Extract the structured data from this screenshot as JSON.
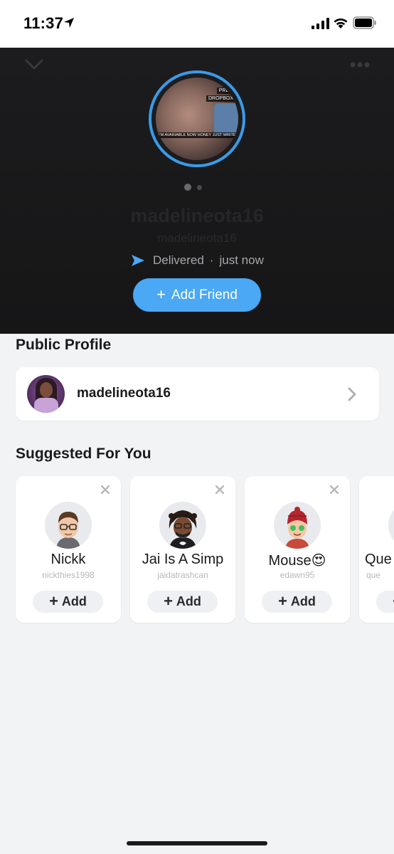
{
  "status_bar": {
    "time": "11:37"
  },
  "profile": {
    "display_name": "madelineota16",
    "username": "madelineota16",
    "status": "Delivered",
    "separator": "·",
    "status_time": "just now",
    "add_friend_label": "Add Friend",
    "story_overlay_1": "PREM",
    "story_overlay_2": "DROPBOX",
    "story_overlay_3": "I'M AVARIABLE NOW HONEY JUST WRITE ME"
  },
  "public_profile": {
    "title": "Public Profile",
    "name": "madelineota16"
  },
  "suggested": {
    "title": "Suggested For You",
    "add_label": "Add",
    "cards": [
      {
        "name": "Nickk",
        "username": "nickthies1998",
        "icon": "bitmoji-avatar-icon"
      },
      {
        "name": "Jai Is A Simp",
        "username": "jaidatrashcan",
        "icon": "bitmoji-avatar-icon"
      },
      {
        "name": "Mouse😍",
        "username": "edawn95",
        "icon": "bitmoji-avatar-icon"
      },
      {
        "name": "Que",
        "username": "que",
        "icon": "bitmoji-avatar-icon"
      }
    ]
  },
  "colors": {
    "accent": "#4aa8f5",
    "ring": "#3a9bea",
    "header_bg": "#1c1c1e",
    "page_bg": "#f2f3f5"
  }
}
